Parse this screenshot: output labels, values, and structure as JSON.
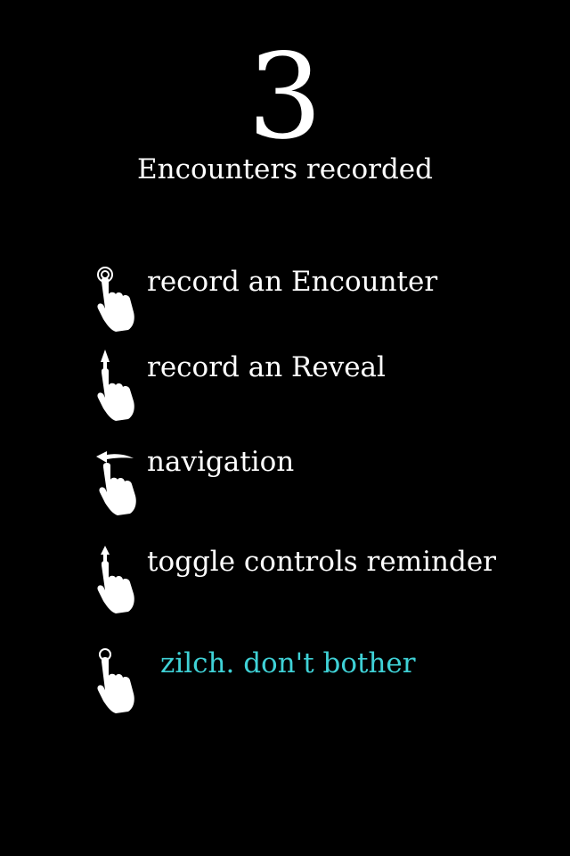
{
  "stats": {
    "count": "3",
    "label": "Encounters recorded"
  },
  "gestures": [
    {
      "icon": "tap-hand-icon",
      "label": "record an Encounter"
    },
    {
      "icon": "swipe-up-hand-icon",
      "label": "record an Reveal"
    },
    {
      "icon": "swipe-left-hand-icon",
      "label": "navigation"
    },
    {
      "icon": "swipe-up-hand-icon",
      "label": "toggle controls reminder"
    },
    {
      "icon": "tap-hand-icon",
      "label": "zilch. don't bother"
    }
  ],
  "colors": {
    "background": "#000000",
    "text": "#ffffff",
    "accent": "#3fd1d6"
  }
}
